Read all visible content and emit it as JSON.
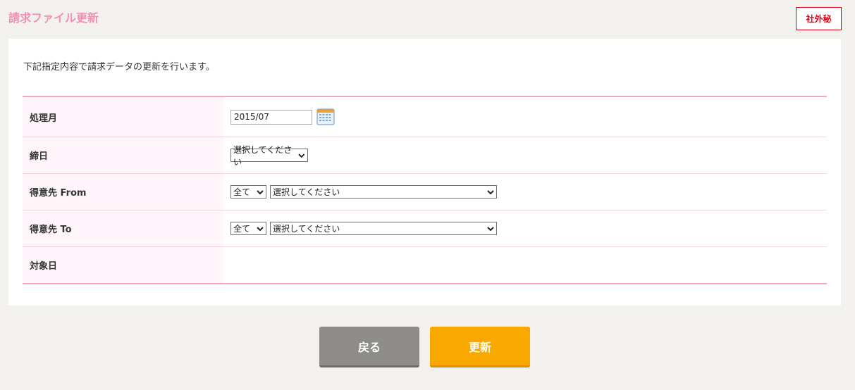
{
  "header": {
    "title": "請求ファイル更新",
    "confidential_badge": "社外秘"
  },
  "main": {
    "description": "下記指定内容で請求データの更新を行います。",
    "form": {
      "processing_month": {
        "label": "処理月",
        "value": "2015/07",
        "icon": "calendar-icon"
      },
      "closing_date": {
        "label": "締日",
        "selected": "選択してください"
      },
      "customer_from": {
        "label": "得意先 From",
        "group_selected": "全て",
        "customer_selected": "選択してください"
      },
      "customer_to": {
        "label": "得意先 To",
        "group_selected": "全て",
        "customer_selected": "選択してください"
      },
      "target_date": {
        "label": "対象日"
      }
    }
  },
  "buttons": {
    "back_label": "戻る",
    "update_label": "更新"
  },
  "colors": {
    "title": "#f28fb5",
    "table_border": "#f4a6c4",
    "label_bg": "#fff5fa",
    "confidential": "#e0001a",
    "back_button": "#8e8d89",
    "update_button": "#f9a800"
  }
}
